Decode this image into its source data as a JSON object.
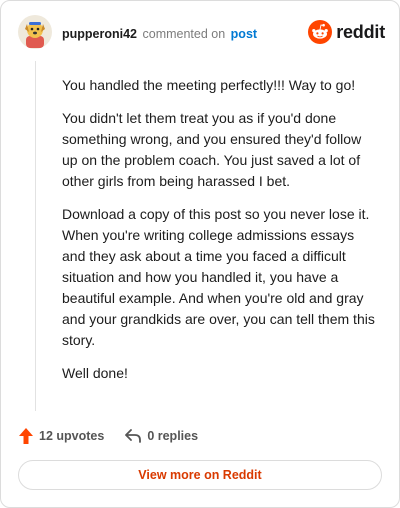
{
  "header": {
    "username": "pupperoni42",
    "action": "commented on",
    "link": "post",
    "logo_icon": "reddit-snoo-icon",
    "logo_text": "reddit",
    "brand_color": "#ff4500"
  },
  "comment": {
    "paragraphs": [
      "You handled the meeting perfectly!!! Way to go!",
      "You didn't let them treat you as if you'd done something wrong, and you ensured they'd follow up on the problem coach. You just saved a lot of other girls from being harassed I bet.",
      "Download a copy of this post so you never lose it. When you're writing college admissions essays and they ask about a time you faced a difficult situation and how you handled it, you have a beautiful example. And when you're old and gray and your grandkids are over, you can tell them this story.",
      "Well done!"
    ]
  },
  "stats": {
    "upvotes": "12 upvotes",
    "upvote_icon": "upvote-arrow-icon",
    "replies": "0 replies",
    "reply_icon": "reply-arrow-icon"
  },
  "footer": {
    "view_more": "View more on Reddit",
    "accent": "#d93a00"
  }
}
